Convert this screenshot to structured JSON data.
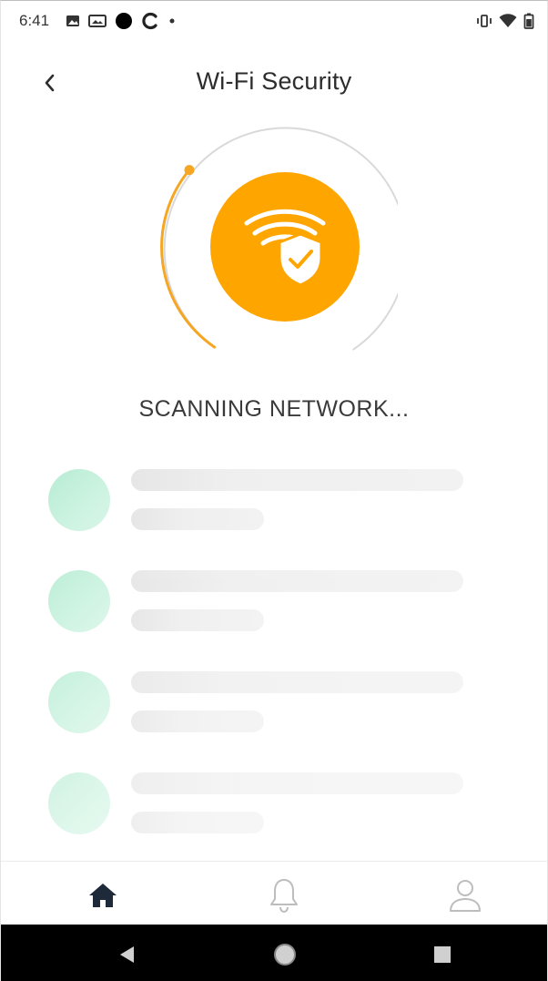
{
  "status_bar": {
    "time": "6:41",
    "left_icons": [
      "image-icon",
      "gallery-icon",
      "circle-icon",
      "c-icon",
      "dot-icon"
    ],
    "right_icons": [
      "vibrate-icon",
      "wifi-icon",
      "battery-icon"
    ]
  },
  "header": {
    "title": "Wi-Fi Security",
    "back_icon": "chevron-left-icon"
  },
  "scan": {
    "status_text": "SCANNING NETWORK...",
    "icon": "wifi-shield-check-icon",
    "colors": {
      "accent": "#FFA500",
      "ring": "#D9D9D9",
      "progress": "#F5A623"
    }
  },
  "skeleton_rows": 4,
  "skeleton_colors": {
    "avatar": "#C4EFDA",
    "line": "#EBEBEB"
  },
  "bottom_nav": {
    "items": [
      {
        "icon": "home-icon",
        "active": true
      },
      {
        "icon": "bell-icon",
        "active": false
      },
      {
        "icon": "user-icon",
        "active": false
      }
    ],
    "colors": {
      "active": "#1E2A3A",
      "inactive": "#BDBDBD"
    }
  },
  "system_nav": {
    "buttons": [
      "back-triangle-icon",
      "home-circle-icon",
      "recents-square-icon"
    ]
  }
}
